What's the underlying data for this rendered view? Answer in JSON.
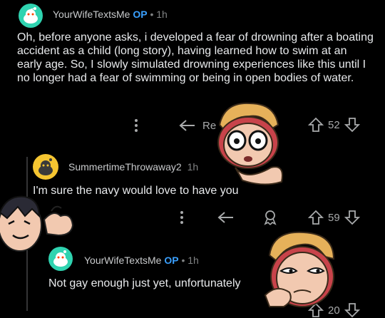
{
  "comments": [
    {
      "username": "YourWifeTextsMe",
      "op_badge": "OP",
      "separator": "•",
      "time": "1h",
      "body": "Oh, before anyone asks, i developed a fear of drowning after a boating accident as a child (long story), having learned how to swim at an early age. So, I slowly simulated drowning experiences like this until I no longer had a fear of swimming or being in open bodies of water.",
      "reply_label": "Re",
      "votes": "52"
    },
    {
      "username": "SummertimeThrowaway2",
      "time": "1h",
      "body": "I'm sure the navy would love to have you",
      "votes": "59"
    },
    {
      "username": "YourWifeTextsMe",
      "op_badge": "OP",
      "separator": "•",
      "time": "1h",
      "body": "Not gay enough just yet, unfortunately",
      "votes": "20"
    }
  ],
  "colors": {
    "background": "#000000",
    "op_accent": "#3aa0ff",
    "avatar_teal": "#2fd3b0",
    "avatar_yellow": "#f5c531"
  },
  "icons": [
    "snoo-avatar-icon",
    "more-options-icon",
    "reply-arrow-icon",
    "award-icon",
    "upvote-icon",
    "downvote-icon"
  ]
}
